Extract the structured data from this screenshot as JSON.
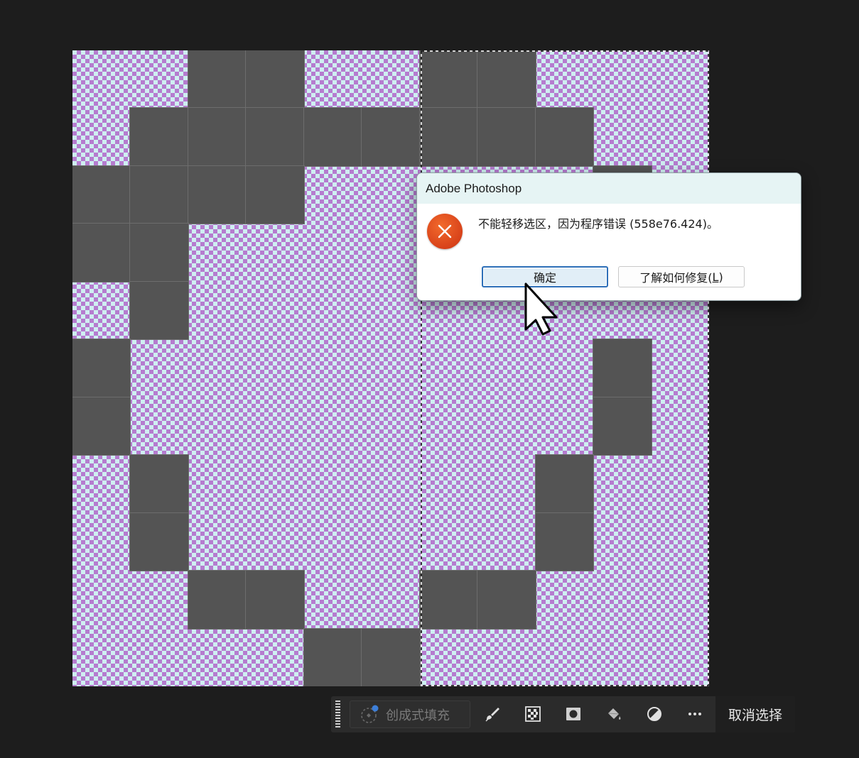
{
  "dialog": {
    "title": "Adobe Photoshop",
    "message": "不能轻移选区，因为程序错误 (558e76.424)。",
    "ok_label": "确定",
    "learn_label": "了解如何修复(",
    "learn_mnemonic": "L",
    "learn_suffix": ")",
    "icon": "error-icon"
  },
  "taskbar": {
    "generative_fill_label": "创成式填充",
    "deselect_label": "取消选择",
    "tools": [
      {
        "name": "brush-icon"
      },
      {
        "name": "mask-checker-icon"
      },
      {
        "name": "mask-icon"
      },
      {
        "name": "fill-bucket-icon"
      },
      {
        "name": "adjustment-icon"
      },
      {
        "name": "more-icon"
      }
    ]
  },
  "canvas": {
    "grid_cols": 11,
    "grid_rows": 11,
    "filled_cells": [
      [
        0,
        2
      ],
      [
        0,
        3
      ],
      [
        0,
        6
      ],
      [
        0,
        7
      ],
      [
        1,
        1
      ],
      [
        1,
        2
      ],
      [
        1,
        3
      ],
      [
        1,
        4
      ],
      [
        1,
        5
      ],
      [
        1,
        6
      ],
      [
        1,
        7
      ],
      [
        1,
        8
      ],
      [
        2,
        0
      ],
      [
        2,
        1
      ],
      [
        2,
        2
      ],
      [
        2,
        3
      ],
      [
        2,
        9
      ],
      [
        3,
        0
      ],
      [
        3,
        1
      ],
      [
        4,
        1
      ],
      [
        5,
        0
      ],
      [
        5,
        9
      ],
      [
        6,
        0
      ],
      [
        6,
        9
      ],
      [
        7,
        1
      ],
      [
        7,
        8
      ],
      [
        8,
        1
      ],
      [
        8,
        8
      ],
      [
        9,
        2
      ],
      [
        9,
        3
      ],
      [
        9,
        6
      ],
      [
        9,
        7
      ],
      [
        10,
        4
      ],
      [
        10,
        5
      ]
    ],
    "colors": {
      "cell": "#545454",
      "checker_a": "#b57ccf",
      "checker_b": "#cfeff1",
      "background": "#1d1d1d"
    }
  }
}
